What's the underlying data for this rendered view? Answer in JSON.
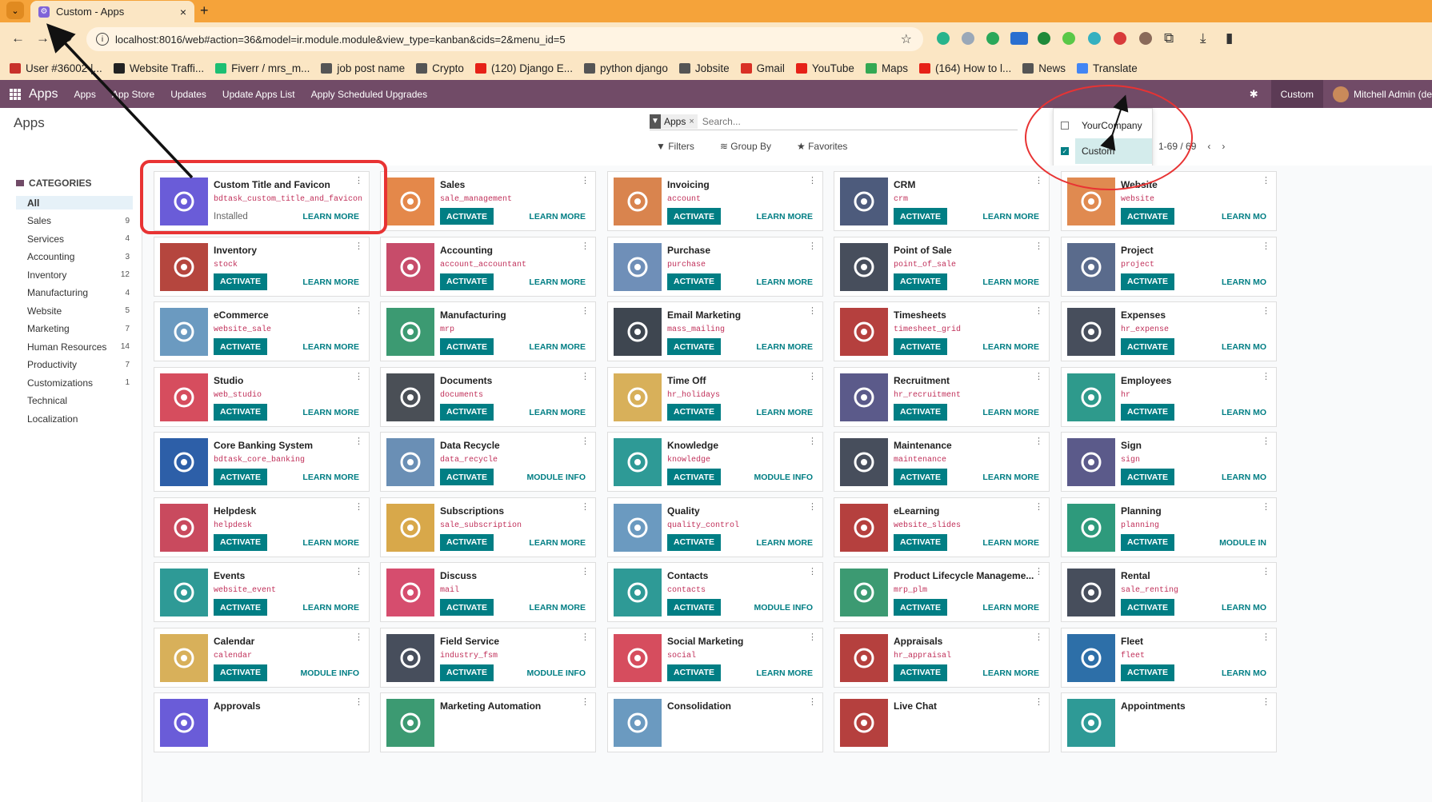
{
  "browser": {
    "tab_title": "Custom - Apps",
    "tab_close": "×",
    "new_tab": "+",
    "url": "localhost:8016/web#action=36&model=ir.module.module&view_type=kanban&cids=2&menu_id=5",
    "bookmarks": [
      {
        "label": "User #36002 |...",
        "color": "#c8312a"
      },
      {
        "label": "Website Traffi...",
        "color": "#222222"
      },
      {
        "label": "Fiverr / mrs_m...",
        "color": "#1dbf73"
      },
      {
        "label": "job post name",
        "color": "#555555"
      },
      {
        "label": "Crypto",
        "color": "#555555"
      },
      {
        "label": "(120) Django E...",
        "color": "#e62117"
      },
      {
        "label": "python django",
        "color": "#555555"
      },
      {
        "label": "Jobsite",
        "color": "#555555"
      },
      {
        "label": "Gmail",
        "color": "#d93025"
      },
      {
        "label": "YouTube",
        "color": "#e62117"
      },
      {
        "label": "Maps",
        "color": "#34a853"
      },
      {
        "label": "(164) How to l...",
        "color": "#e62117"
      },
      {
        "label": "News",
        "color": "#555555"
      },
      {
        "label": "Translate",
        "color": "#4285f4"
      }
    ]
  },
  "nav": {
    "brand": "Apps",
    "links": [
      "Apps",
      "App Store",
      "Updates",
      "Update Apps List",
      "Apply Scheduled Upgrades"
    ],
    "company": "Custom",
    "user": "Mitchell Admin (de"
  },
  "control_panel": {
    "title": "Apps",
    "facet": "Apps",
    "search_placeholder": "Search...",
    "filters": "Filters",
    "group_by": "Group By",
    "favorites": "Favorites",
    "pager": "1-69 / 69"
  },
  "company_dropdown": [
    {
      "label": "YourCompany",
      "checked": false
    },
    {
      "label": "Custom",
      "checked": true
    }
  ],
  "categories": {
    "title": "CATEGORIES",
    "items": [
      {
        "label": "All",
        "count": ""
      },
      {
        "label": "Sales",
        "count": "9"
      },
      {
        "label": "Services",
        "count": "4"
      },
      {
        "label": "Accounting",
        "count": "3"
      },
      {
        "label": "Inventory",
        "count": "12"
      },
      {
        "label": "Manufacturing",
        "count": "4"
      },
      {
        "label": "Website",
        "count": "5"
      },
      {
        "label": "Marketing",
        "count": "7"
      },
      {
        "label": "Human Resources",
        "count": "14"
      },
      {
        "label": "Productivity",
        "count": "7"
      },
      {
        "label": "Customizations",
        "count": "1"
      },
      {
        "label": "Technical",
        "count": ""
      },
      {
        "label": "Localization",
        "count": ""
      }
    ]
  },
  "apps": [
    {
      "name": "Custom Title and Favicon",
      "tech": "bdtask_custom_title_and_favicon",
      "status": "Installed",
      "action": "",
      "more": "LEARN MORE",
      "color": "#6a5cd8",
      "icon": "gear-icon"
    },
    {
      "name": "Sales",
      "tech": "sale_management",
      "action": "ACTIVATE",
      "more": "LEARN MORE",
      "color": "#e4884a",
      "icon": "chart-icon"
    },
    {
      "name": "Invoicing",
      "tech": "account",
      "action": "ACTIVATE",
      "more": "LEARN MORE",
      "color": "#d9844e",
      "icon": "invoice-icon"
    },
    {
      "name": "CRM",
      "tech": "crm",
      "action": "ACTIVATE",
      "more": "LEARN MORE",
      "color": "#4d5b7c",
      "icon": "handshake-icon"
    },
    {
      "name": "Website",
      "tech": "website",
      "action": "ACTIVATE",
      "more": "LEARN MO",
      "color": "#e08a50",
      "icon": "globe-icon"
    },
    {
      "name": "Inventory",
      "tech": "stock",
      "action": "ACTIVATE",
      "more": "LEARN MORE",
      "color": "#b5463e",
      "icon": "box-icon"
    },
    {
      "name": "Accounting",
      "tech": "account_accountant",
      "action": "ACTIVATE",
      "more": "LEARN MORE",
      "color": "#c74c6a",
      "icon": "document-icon"
    },
    {
      "name": "Purchase",
      "tech": "purchase",
      "action": "ACTIVATE",
      "more": "LEARN MORE",
      "color": "#6f8fb8",
      "icon": "card-icon"
    },
    {
      "name": "Point of Sale",
      "tech": "point_of_sale",
      "action": "ACTIVATE",
      "more": "LEARN MORE",
      "color": "#474e5c",
      "icon": "shop-icon"
    },
    {
      "name": "Project",
      "tech": "project",
      "action": "ACTIVATE",
      "more": "LEARN MO",
      "color": "#5a6b8c",
      "icon": "puzzle-icon"
    },
    {
      "name": "eCommerce",
      "tech": "website_sale",
      "action": "ACTIVATE",
      "more": "LEARN MORE",
      "color": "#6b9ac0",
      "icon": "cart-icon"
    },
    {
      "name": "Manufacturing",
      "tech": "mrp",
      "action": "ACTIVATE",
      "more": "LEARN MORE",
      "color": "#3c9a72",
      "icon": "wrench-icon"
    },
    {
      "name": "Email Marketing",
      "tech": "mass_mailing",
      "action": "ACTIVATE",
      "more": "LEARN MORE",
      "color": "#3e4650",
      "icon": "paper-plane-icon"
    },
    {
      "name": "Timesheets",
      "tech": "timesheet_grid",
      "action": "ACTIVATE",
      "more": "LEARN MORE",
      "color": "#b5403e",
      "icon": "stopwatch-icon"
    },
    {
      "name": "Expenses",
      "tech": "hr_expense",
      "action": "ACTIVATE",
      "more": "LEARN MO",
      "color": "#474e5c",
      "icon": "expense-icon"
    },
    {
      "name": "Studio",
      "tech": "web_studio",
      "action": "ACTIVATE",
      "more": "LEARN MORE",
      "color": "#d64d5e",
      "icon": "tools-icon"
    },
    {
      "name": "Documents",
      "tech": "documents",
      "action": "ACTIVATE",
      "more": "LEARN MORE",
      "color": "#4a4f56",
      "icon": "folder-icon"
    },
    {
      "name": "Time Off",
      "tech": "hr_holidays",
      "action": "ACTIVATE",
      "more": "LEARN MORE",
      "color": "#d8b05a",
      "icon": "person-gear-icon"
    },
    {
      "name": "Recruitment",
      "tech": "hr_recruitment",
      "action": "ACTIVATE",
      "more": "LEARN MORE",
      "color": "#5b5a8a",
      "icon": "magnifier-icon"
    },
    {
      "name": "Employees",
      "tech": "hr",
      "action": "ACTIVATE",
      "more": "LEARN MO",
      "color": "#2e9a8c",
      "icon": "people-icon"
    },
    {
      "name": "Core Banking System",
      "tech": "bdtask_core_banking",
      "action": "ACTIVATE",
      "more": "LEARN MORE",
      "color": "#2d5fa8",
      "icon": "bank-icon"
    },
    {
      "name": "Data Recycle",
      "tech": "data_recycle",
      "action": "ACTIVATE",
      "more": "MODULE INFO",
      "color": "#6a8fb5",
      "icon": "broom-icon"
    },
    {
      "name": "Knowledge",
      "tech": "knowledge",
      "action": "ACTIVATE",
      "more": "MODULE INFO",
      "color": "#2e9a96",
      "icon": "book-icon"
    },
    {
      "name": "Maintenance",
      "tech": "maintenance",
      "action": "ACTIVATE",
      "more": "LEARN MORE",
      "color": "#474e5c",
      "icon": "hammer-icon"
    },
    {
      "name": "Sign",
      "tech": "sign",
      "action": "ACTIVATE",
      "more": "LEARN MO",
      "color": "#5b5a8a",
      "icon": "sign-icon"
    },
    {
      "name": "Helpdesk",
      "tech": "helpdesk",
      "action": "ACTIVATE",
      "more": "LEARN MORE",
      "color": "#c94a5e",
      "icon": "lifebuoy-icon"
    },
    {
      "name": "Subscriptions",
      "tech": "sale_subscription",
      "action": "ACTIVATE",
      "more": "LEARN MORE",
      "color": "#d8a84a",
      "icon": "refresh-icon"
    },
    {
      "name": "Quality",
      "tech": "quality_control",
      "action": "ACTIVATE",
      "more": "LEARN MORE",
      "color": "#6b9ac0",
      "icon": "badge-icon"
    },
    {
      "name": "eLearning",
      "tech": "website_slides",
      "action": "ACTIVATE",
      "more": "LEARN MORE",
      "color": "#b5403e",
      "icon": "presentation-icon"
    },
    {
      "name": "Planning",
      "tech": "planning",
      "action": "ACTIVATE",
      "more": "MODULE IN",
      "color": "#2e9a7c",
      "icon": "planning-icon"
    },
    {
      "name": "Events",
      "tech": "website_event",
      "action": "ACTIVATE",
      "more": "LEARN MORE",
      "color": "#2e9a96",
      "icon": "ticket-icon"
    },
    {
      "name": "Discuss",
      "tech": "mail",
      "action": "ACTIVATE",
      "more": "LEARN MORE",
      "color": "#d64d6e",
      "icon": "chat-icon"
    },
    {
      "name": "Contacts",
      "tech": "contacts",
      "action": "ACTIVATE",
      "more": "MODULE INFO",
      "color": "#2e9a96",
      "icon": "contact-book-icon"
    },
    {
      "name": "Product Lifecycle Manageme...",
      "tech": "mrp_plm",
      "action": "ACTIVATE",
      "more": "LEARN MORE",
      "color": "#3c9a72",
      "icon": "cycle-icon"
    },
    {
      "name": "Rental",
      "tech": "sale_renting",
      "action": "ACTIVATE",
      "more": "LEARN MO",
      "color": "#474e5c",
      "icon": "table-icon"
    },
    {
      "name": "Calendar",
      "tech": "calendar",
      "action": "ACTIVATE",
      "more": "MODULE INFO",
      "color": "#d8b05a",
      "icon": "calendar-icon"
    },
    {
      "name": "Field Service",
      "tech": "industry_fsm",
      "action": "ACTIVATE",
      "more": "MODULE INFO",
      "color": "#474e5c",
      "icon": "field-icon"
    },
    {
      "name": "Social Marketing",
      "tech": "social",
      "action": "ACTIVATE",
      "more": "LEARN MORE",
      "color": "#d64d5e",
      "icon": "thumbs-up-icon"
    },
    {
      "name": "Appraisals",
      "tech": "hr_appraisal",
      "action": "ACTIVATE",
      "more": "LEARN MORE",
      "color": "#b5403e",
      "icon": "star-icon"
    },
    {
      "name": "Fleet",
      "tech": "fleet",
      "action": "ACTIVATE",
      "more": "LEARN MO",
      "color": "#2d6fa8",
      "icon": "car-icon"
    },
    {
      "name": "Approvals",
      "tech": "",
      "action": "",
      "more": "",
      "color": "#6a5cd8",
      "icon": "approval-icon"
    },
    {
      "name": "Marketing Automation",
      "tech": "",
      "action": "",
      "more": "",
      "color": "#3c9a72",
      "icon": "automation-icon"
    },
    {
      "name": "Consolidation",
      "tech": "",
      "action": "",
      "more": "",
      "color": "#6b9ac0",
      "icon": "consolidation-icon"
    },
    {
      "name": "Live Chat",
      "tech": "",
      "action": "",
      "more": "",
      "color": "#b5403e",
      "icon": "livechat-icon"
    },
    {
      "name": "Appointments",
      "tech": "",
      "action": "",
      "more": "",
      "color": "#2e9a96",
      "icon": "appointment-icon"
    }
  ]
}
